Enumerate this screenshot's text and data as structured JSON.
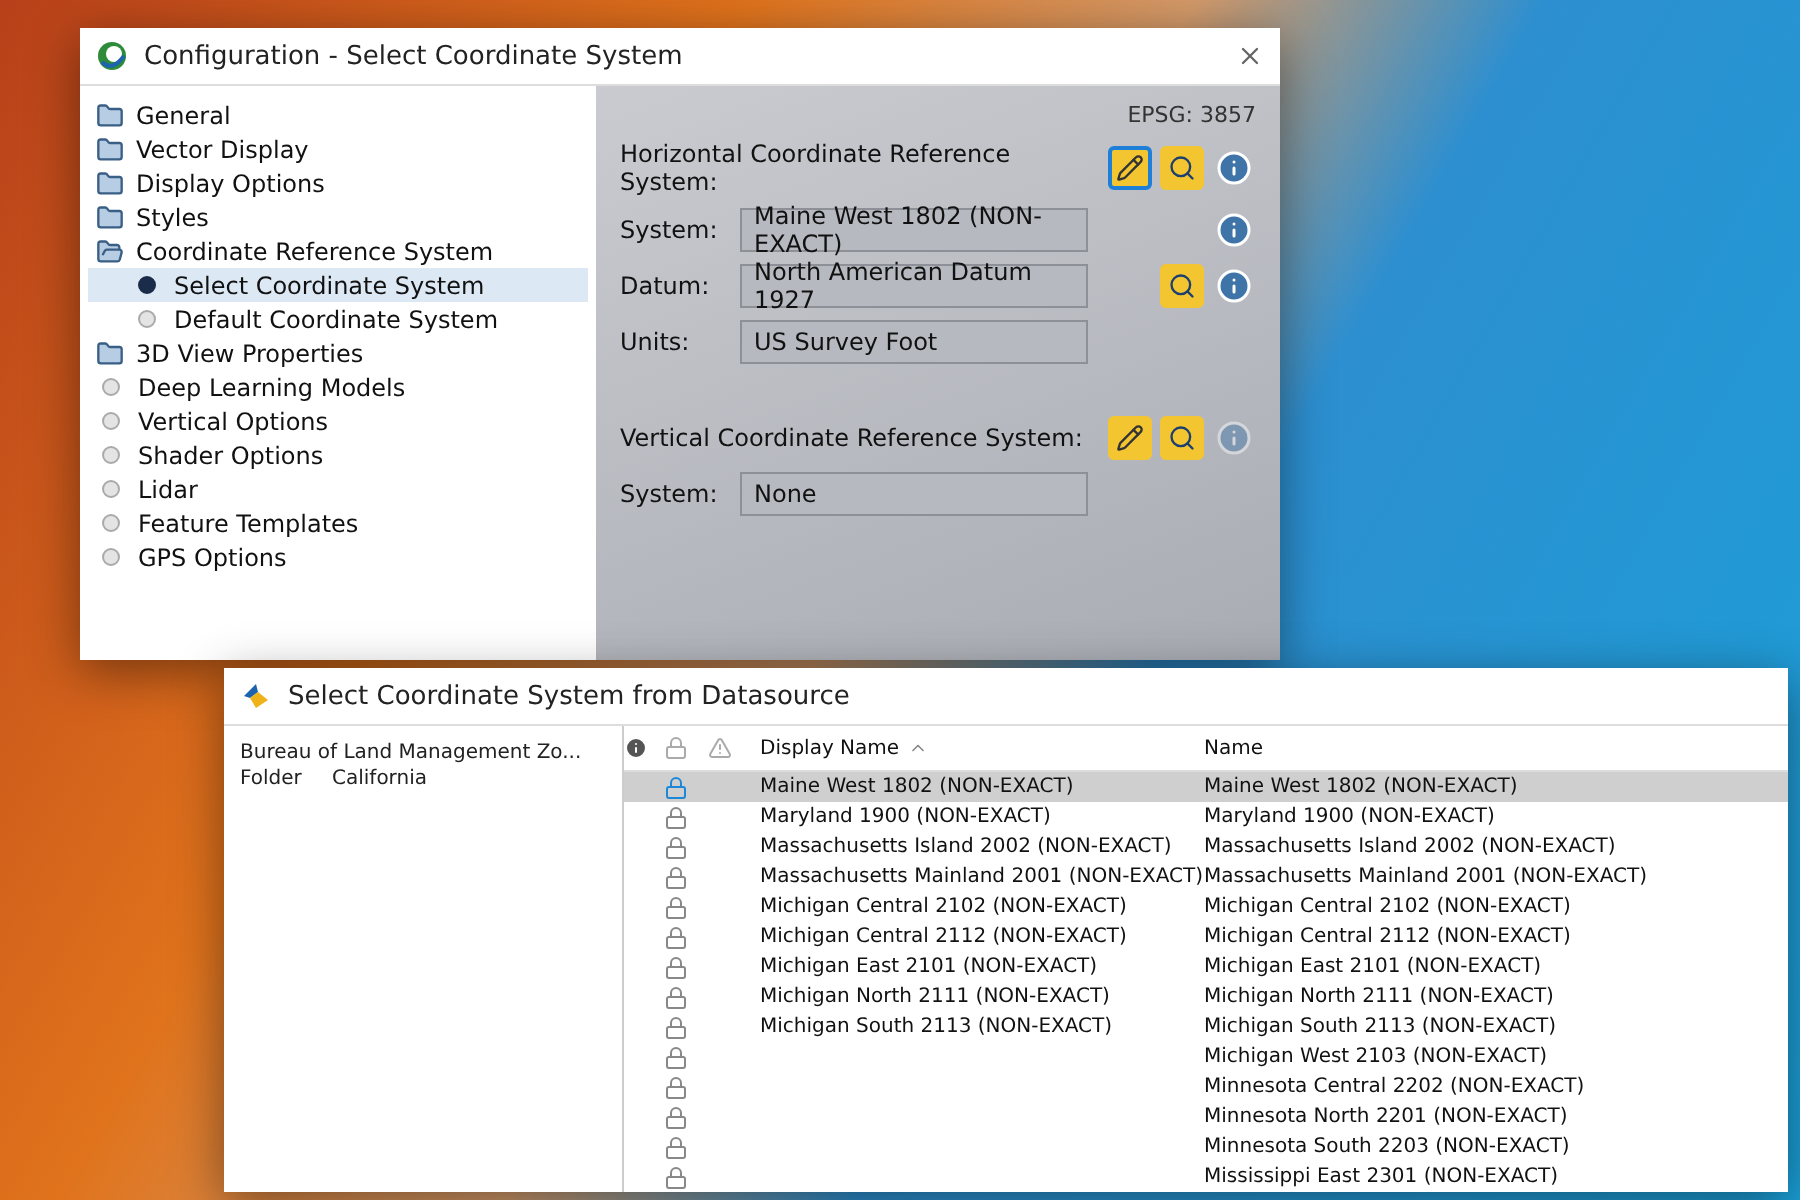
{
  "config_window": {
    "title": "Configuration - Select Coordinate System"
  },
  "sidebar": {
    "items": [
      {
        "label": "General",
        "kind": "folder",
        "expanded": false,
        "selected": false
      },
      {
        "label": "Vector Display",
        "kind": "folder",
        "expanded": false,
        "selected": false
      },
      {
        "label": "Display Options",
        "kind": "folder",
        "expanded": false,
        "selected": false
      },
      {
        "label": "Styles",
        "kind": "folder",
        "expanded": false,
        "selected": false
      },
      {
        "label": "Coordinate Reference System",
        "kind": "folder",
        "expanded": true,
        "selected": false,
        "children": [
          {
            "label": "Select Coordinate System",
            "kind": "bullet",
            "selected": true
          },
          {
            "label": "Default Coordinate System",
            "kind": "bullet",
            "selected": false
          }
        ]
      },
      {
        "label": "3D View Properties",
        "kind": "folder",
        "expanded": false,
        "selected": false
      },
      {
        "label": "Deep Learning Models",
        "kind": "bullet",
        "selected": false
      },
      {
        "label": "Vertical Options",
        "kind": "bullet",
        "selected": false
      },
      {
        "label": "Shader Options",
        "kind": "bullet",
        "selected": false
      },
      {
        "label": "Lidar",
        "kind": "bullet",
        "selected": false
      },
      {
        "label": "Feature Templates",
        "kind": "bullet",
        "selected": false
      },
      {
        "label": "GPS Options",
        "kind": "bullet",
        "selected": false
      }
    ]
  },
  "crs_panel": {
    "epsg": "EPSG: 3857",
    "horizontal": {
      "heading": "Horizontal Coordinate Reference System:",
      "tools": [
        {
          "kind": "edit",
          "selected": true,
          "disabled": false
        },
        {
          "kind": "search",
          "selected": false,
          "disabled": false
        },
        {
          "kind": "info",
          "selected": false,
          "disabled": false
        }
      ],
      "fields": [
        {
          "label": "System:",
          "value": "Maine West 1802 (NON-EXACT)",
          "tools": [
            {
              "kind": "info",
              "selected": false,
              "disabled": false
            }
          ]
        },
        {
          "label": "Datum:",
          "value": "North American Datum 1927",
          "tools": [
            {
              "kind": "search",
              "selected": false,
              "disabled": false
            },
            {
              "kind": "info",
              "selected": false,
              "disabled": false
            }
          ]
        },
        {
          "label": "Units:",
          "value": "US Survey Foot"
        }
      ]
    },
    "vertical": {
      "heading": "Vertical Coordinate Reference System:",
      "tools": [
        {
          "kind": "edit",
          "selected": false,
          "disabled": false
        },
        {
          "kind": "search",
          "selected": false,
          "disabled": false
        },
        {
          "kind": "info",
          "selected": false,
          "disabled": true
        }
      ],
      "fields": [
        {
          "label": "System:",
          "value": "None"
        }
      ]
    }
  },
  "datasource_dialog": {
    "title": "Select Coordinate System from Datasource",
    "details": [
      {
        "value": "Bureau of Land Management Zo..."
      },
      {
        "label": "Folder",
        "value": "California"
      }
    ],
    "table": {
      "columns": [
        "Display Name",
        "Name"
      ],
      "rows": [
        {
          "display_name": "Maine West 1802 (NON-EXACT)",
          "name": "Maine West 1802 (NON-EXACT)",
          "selected": true
        },
        {
          "display_name": "Maryland 1900 (NON-EXACT)",
          "name": "Maryland 1900 (NON-EXACT)",
          "selected": false
        },
        {
          "display_name": "Massachusetts Island 2002 (NON-EXACT)",
          "name": "Massachusetts Island 2002 (NON-EXACT)",
          "selected": false
        },
        {
          "display_name": "Massachusetts Mainland 2001 (NON-EXACT)",
          "name": "Massachusetts Mainland 2001 (NON-EXACT)",
          "selected": false
        },
        {
          "display_name": "Michigan Central 2102 (NON-EXACT)",
          "name": "Michigan Central 2102 (NON-EXACT)",
          "selected": false
        },
        {
          "display_name": "Michigan Central 2112 (NON-EXACT)",
          "name": "Michigan Central 2112 (NON-EXACT)",
          "selected": false
        },
        {
          "display_name": "Michigan East 2101 (NON-EXACT)",
          "name": "Michigan East 2101 (NON-EXACT)",
          "selected": false
        },
        {
          "display_name": "Michigan North 2111 (NON-EXACT)",
          "name": "Michigan North 2111 (NON-EXACT)",
          "selected": false
        },
        {
          "display_name": "Michigan South 2113 (NON-EXACT)",
          "name": "Michigan South 2113 (NON-EXACT)",
          "selected": false
        },
        {
          "name": "Michigan West 2103 (NON-EXACT)",
          "selected": false
        },
        {
          "name": "Minnesota Central 2202 (NON-EXACT)",
          "selected": false
        },
        {
          "name": "Minnesota North 2201 (NON-EXACT)",
          "selected": false
        },
        {
          "name": "Minnesota South 2203 (NON-EXACT)",
          "selected": false
        },
        {
          "name": "Mississippi East 2301 (NON-EXACT)",
          "selected": false
        }
      ]
    }
  }
}
